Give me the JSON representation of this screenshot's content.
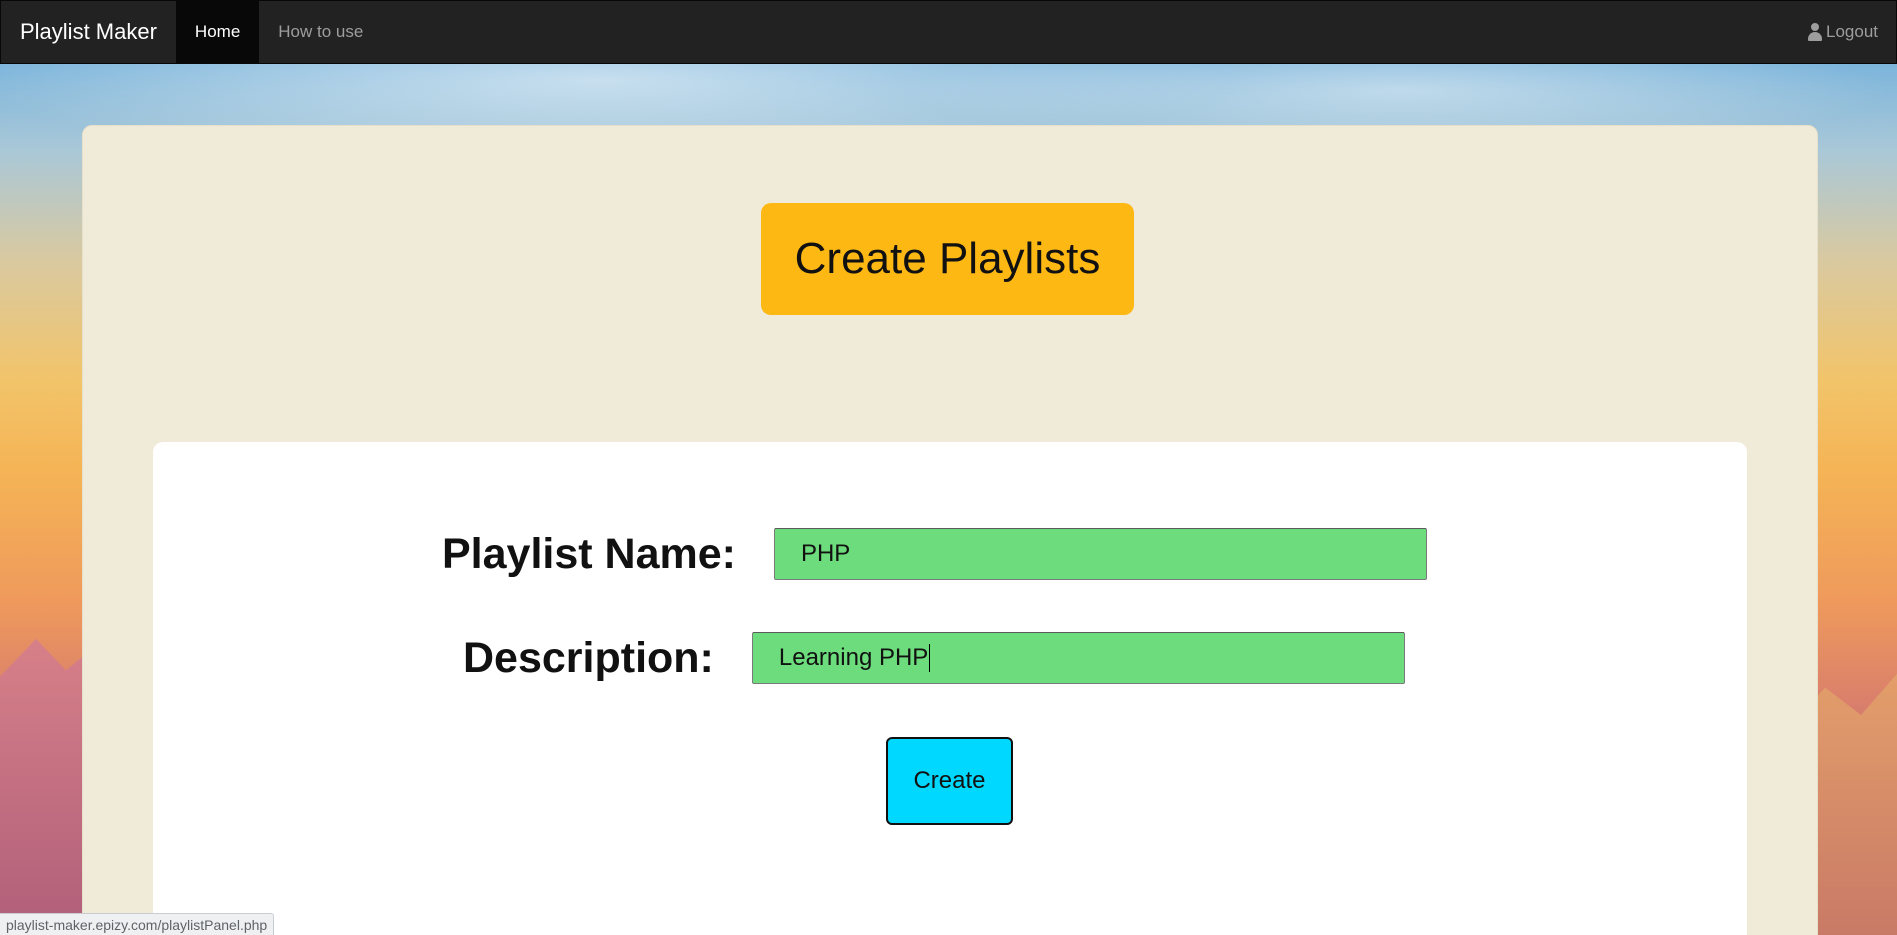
{
  "navbar": {
    "brand": "Playlist Maker",
    "items": [
      {
        "label": "Home",
        "active": true
      },
      {
        "label": "How to use",
        "active": false
      }
    ],
    "logout_label": "Logout",
    "logout_icon": "user-icon"
  },
  "main": {
    "heading_button": "Create Playlists",
    "form": {
      "name_label": "Playlist Name:",
      "name_value": "PHP",
      "description_label": "Description:",
      "description_value": "Learning PHP",
      "submit_label": "Create"
    }
  },
  "status_bar": {
    "url": "playlist-maker.epizy.com/playlistPanel.php"
  },
  "colors": {
    "navbar_bg": "#222222",
    "panel_bg": "#f0ead8",
    "heading_button_bg": "#fdb813",
    "input_bg": "#6ddc7c",
    "submit_bg": "#00d8ff"
  }
}
